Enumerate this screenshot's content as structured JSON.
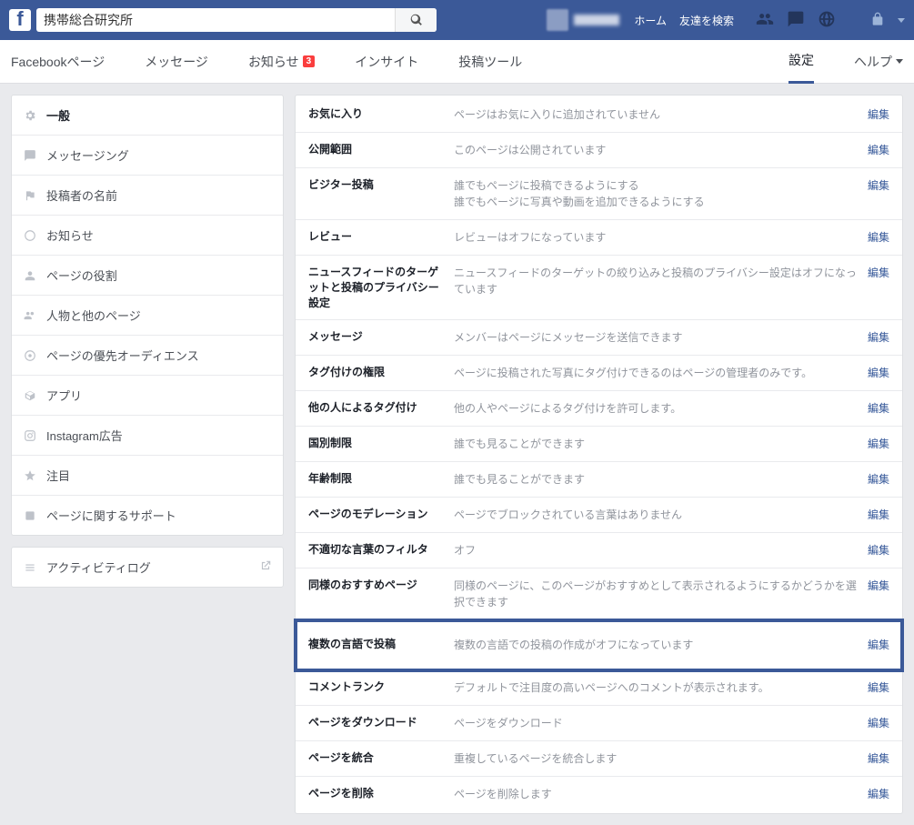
{
  "top": {
    "search_value": "携帯総合研究所",
    "home": "ホーム",
    "find_friends": "友達を検索"
  },
  "subnav": {
    "page": "Facebookページ",
    "messages": "メッセージ",
    "notice": "お知らせ",
    "notice_badge": "3",
    "insight": "インサイト",
    "posttool": "投稿ツール",
    "settings": "設定",
    "help": "ヘルプ"
  },
  "sidebar": {
    "items": [
      {
        "label": "一般"
      },
      {
        "label": "メッセージング"
      },
      {
        "label": "投稿者の名前"
      },
      {
        "label": "お知らせ"
      },
      {
        "label": "ページの役割"
      },
      {
        "label": "人物と他のページ"
      },
      {
        "label": "ページの優先オーディエンス"
      },
      {
        "label": "アプリ"
      },
      {
        "label": "Instagram広告"
      },
      {
        "label": "注目"
      },
      {
        "label": "ページに関するサポート"
      }
    ],
    "activity": "アクティビティログ"
  },
  "edit_label": "編集",
  "rows": [
    {
      "label": "お気に入り",
      "desc": "ページはお気に入りに追加されていません"
    },
    {
      "label": "公開範囲",
      "desc": "このページは公開されています"
    },
    {
      "label": "ビジター投稿",
      "desc": "誰でもページに投稿できるようにする\n誰でもページに写真や動画を追加できるようにする"
    },
    {
      "label": "レビュー",
      "desc": "レビューはオフになっています"
    },
    {
      "label": "ニュースフィードのターゲットと投稿のプライバシー設定",
      "desc": "ニュースフィードのターゲットの絞り込みと投稿のプライバシー設定はオフになっています"
    },
    {
      "label": "メッセージ",
      "desc": "メンバーはページにメッセージを送信できます"
    },
    {
      "label": "タグ付けの権限",
      "desc": "ページに投稿された写真にタグ付けできるのはページの管理者のみです。"
    },
    {
      "label": "他の人によるタグ付け",
      "desc": "他の人やページによるタグ付けを許可します。"
    },
    {
      "label": "国別制限",
      "desc": "誰でも見ることができます"
    },
    {
      "label": "年齢制限",
      "desc": "誰でも見ることができます"
    },
    {
      "label": "ページのモデレーション",
      "desc": "ページでブロックされている言葉はありません"
    },
    {
      "label": "不適切な言葉のフィルタ",
      "desc": "オフ"
    },
    {
      "label": "同様のおすすめページ",
      "desc": "同様のページに、このページがおすすめとして表示されるようにするかどうかを選択できます"
    },
    {
      "label": "複数の言語で投稿",
      "desc": "複数の言語での投稿の作成がオフになっています"
    },
    {
      "label": "コメントランク",
      "desc": "デフォルトで注目度の高いページへのコメントが表示されます。"
    },
    {
      "label": "ページをダウンロード",
      "desc": "ページをダウンロード"
    },
    {
      "label": "ページを統合",
      "desc": "重複しているページを統合します"
    },
    {
      "label": "ページを削除",
      "desc": "ページを削除します"
    }
  ]
}
